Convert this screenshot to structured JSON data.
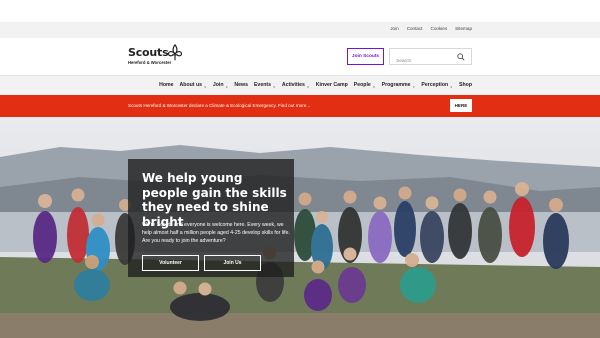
{
  "top_links": [
    "Join",
    "Contact",
    "Cookies",
    "Sitemap"
  ],
  "brand": {
    "name": "Scouts",
    "subtitle": "Hereford & Worcester"
  },
  "header": {
    "join_label": "Join Scouts",
    "search_placeholder": "Search"
  },
  "nav": [
    {
      "label": "Home",
      "dropdown": false
    },
    {
      "label": "About us",
      "dropdown": true
    },
    {
      "label": "Join",
      "dropdown": true
    },
    {
      "label": "News",
      "dropdown": false
    },
    {
      "label": "Events",
      "dropdown": true
    },
    {
      "label": "Activities",
      "dropdown": true
    },
    {
      "label": "Kinver Camp",
      "dropdown": false
    },
    {
      "label": "People",
      "dropdown": true
    },
    {
      "label": "Programme",
      "dropdown": true
    },
    {
      "label": "Perception",
      "dropdown": true
    },
    {
      "label": "Shop",
      "dropdown": false
    }
  ],
  "banner": {
    "text": "Scouts Hereford & Worcester declare a Climate & Ecological Emergency. Find out more...",
    "button": "HERE"
  },
  "hero": {
    "title": "We help young people gain the skills they need to shine bright",
    "body": "We're Scouts and everyone is welcome here. Every week, we help almost half a million people aged 4-25 develop skills for life. Are you ready to join the adventure?",
    "volunteer_label": "Volunteer",
    "join_label": "Join Us"
  },
  "colors": {
    "brand_purple": "#7413dc",
    "banner_red": "#e22e12",
    "nav_bg": "#f2f2f2"
  }
}
